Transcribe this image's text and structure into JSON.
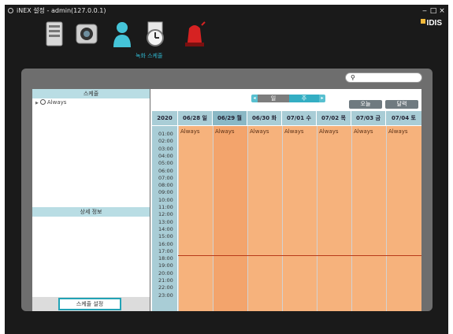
{
  "window": {
    "title": "iNEX 설정 - admin(127.0.0.1)",
    "minimize": "‒",
    "maximize": "□",
    "close": "×"
  },
  "brand": {
    "logo_text": "IDIS"
  },
  "toolbar": {
    "active_label": "녹화 스케줄"
  },
  "left": {
    "schedule_header": "스케줄",
    "tree_item": "Always",
    "detail_header": "상세 정보",
    "set_button": "스케줄 설정"
  },
  "nav": {
    "prev": "◂",
    "week": "일",
    "day": "주",
    "next": "▸",
    "today": "오늘",
    "calendar": "달력"
  },
  "grid": {
    "year": "2020",
    "days": [
      "06/28 일",
      "06/29 월",
      "06/30 화",
      "07/01 수",
      "07/02 목",
      "07/03 금",
      "07/04 토"
    ],
    "entries": [
      "Always",
      "Always",
      "Always",
      "Always",
      "Always",
      "Always",
      "Always"
    ],
    "times": [
      "01:00",
      "02:00",
      "03:00",
      "04:00",
      "05:00",
      "06:00",
      "07:00",
      "08:00",
      "09:00",
      "10:00",
      "11:00",
      "12:00",
      "13:00",
      "14:00",
      "15:00",
      "16:00",
      "17:00",
      "18:00",
      "19:00",
      "20:00",
      "21:00",
      "22:00",
      "23:00"
    ]
  },
  "colors": {
    "accent": "#34aec3",
    "schedule_fill": "#f6b27c",
    "header": "#a9cdd6",
    "current_time_line": "#b83a1a"
  }
}
